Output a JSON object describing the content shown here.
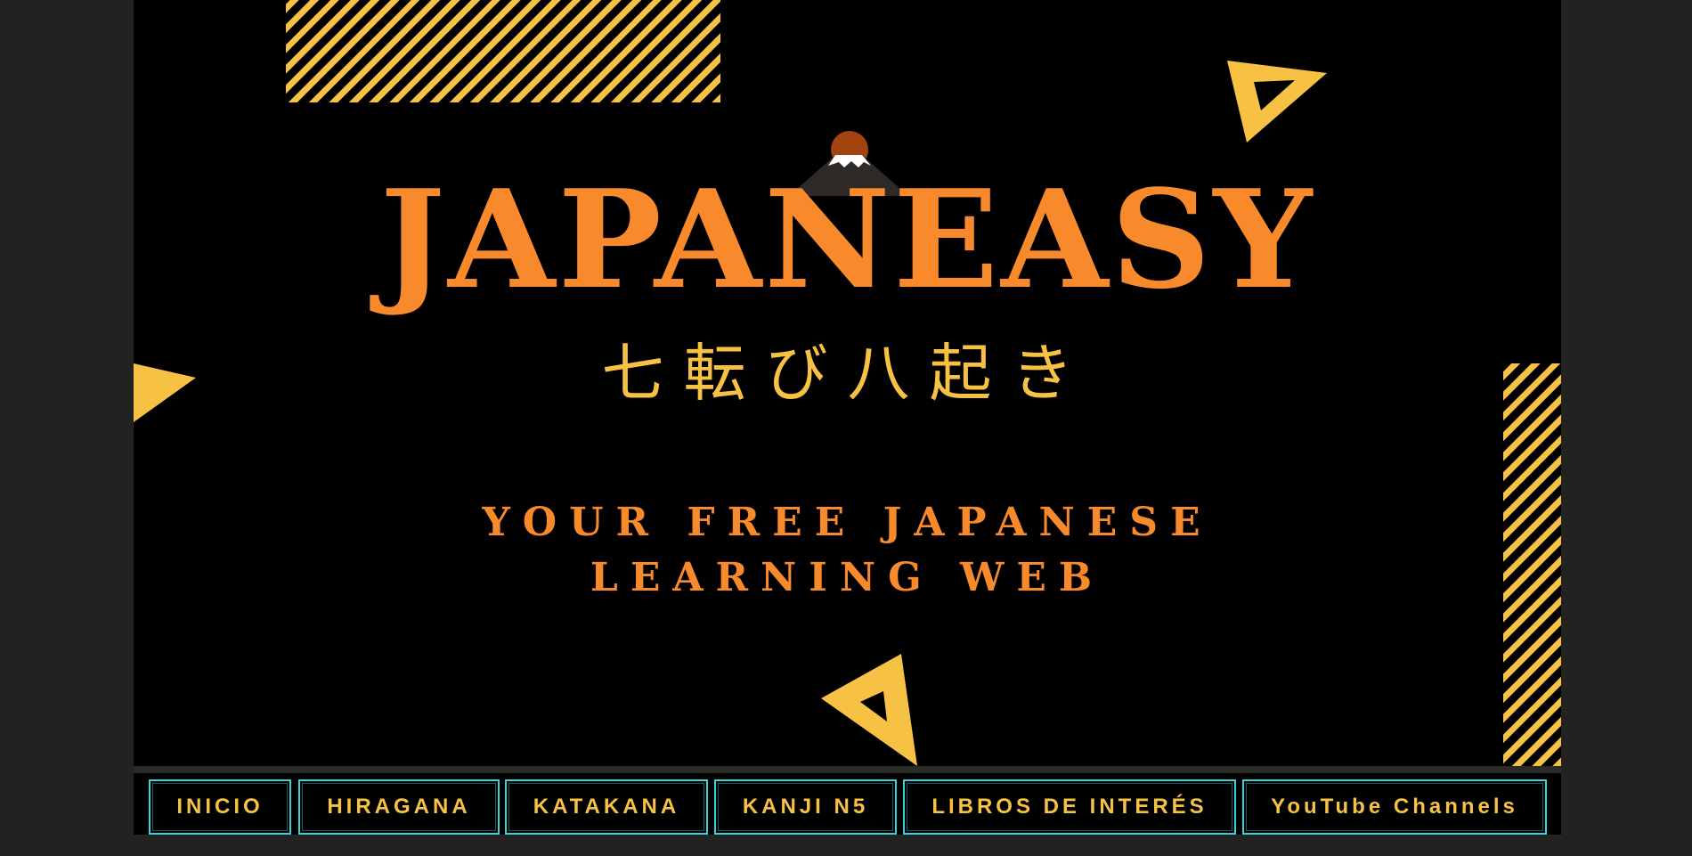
{
  "banner": {
    "title": "JAPANEASY",
    "motto": "七転び八起き",
    "subtitle_line1": "YOUR FREE JAPANESE",
    "subtitle_line2": "LEARNING WEB",
    "logo_icon": "mount-fuji-sun-icon"
  },
  "nav": {
    "items": [
      {
        "label": "INICIO"
      },
      {
        "label": "HIRAGANA"
      },
      {
        "label": "KATAKANA"
      },
      {
        "label": "KANJI N5"
      },
      {
        "label": "LIBROS DE INTERÉS"
      },
      {
        "label": "YouTube Channels"
      }
    ]
  },
  "colors": {
    "background": "#222220",
    "banner": "#000000",
    "title_orange": "#f98a2c",
    "accent_yellow": "#f7c244",
    "button_border": "#3bd1d6"
  }
}
